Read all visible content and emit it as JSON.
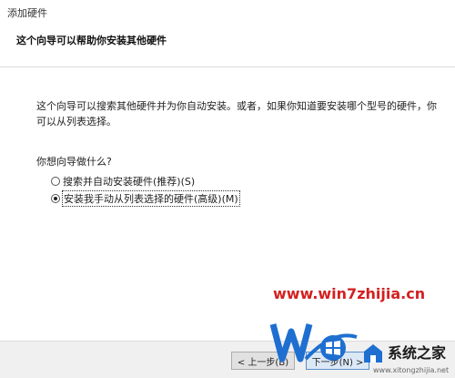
{
  "window": {
    "title": "添加硬件",
    "subtitle": "这个向导可以帮助你安装其他硬件"
  },
  "content": {
    "description": "这个向导可以搜索其他硬件并为你自动安装。或者，如果你知道要安装哪个型号的硬件，你可以从列表选择。",
    "question": "你想向导做什么?",
    "options": [
      {
        "label": "搜索并自动安装硬件(推荐)(S)",
        "checked": false
      },
      {
        "label": "安装我手动从列表选择的硬件(高级)(M)",
        "checked": true
      }
    ]
  },
  "footer": {
    "back_label": "< 上一步(B)",
    "next_label": "下一步(N) >"
  },
  "watermark": {
    "url": "www.win7zhijia.cn",
    "logo_text": "系统之家",
    "logo_sub": "www.xitongzhijia.net",
    "colors": {
      "url": "#d42020",
      "win_blue": "#1e6fd0"
    }
  }
}
